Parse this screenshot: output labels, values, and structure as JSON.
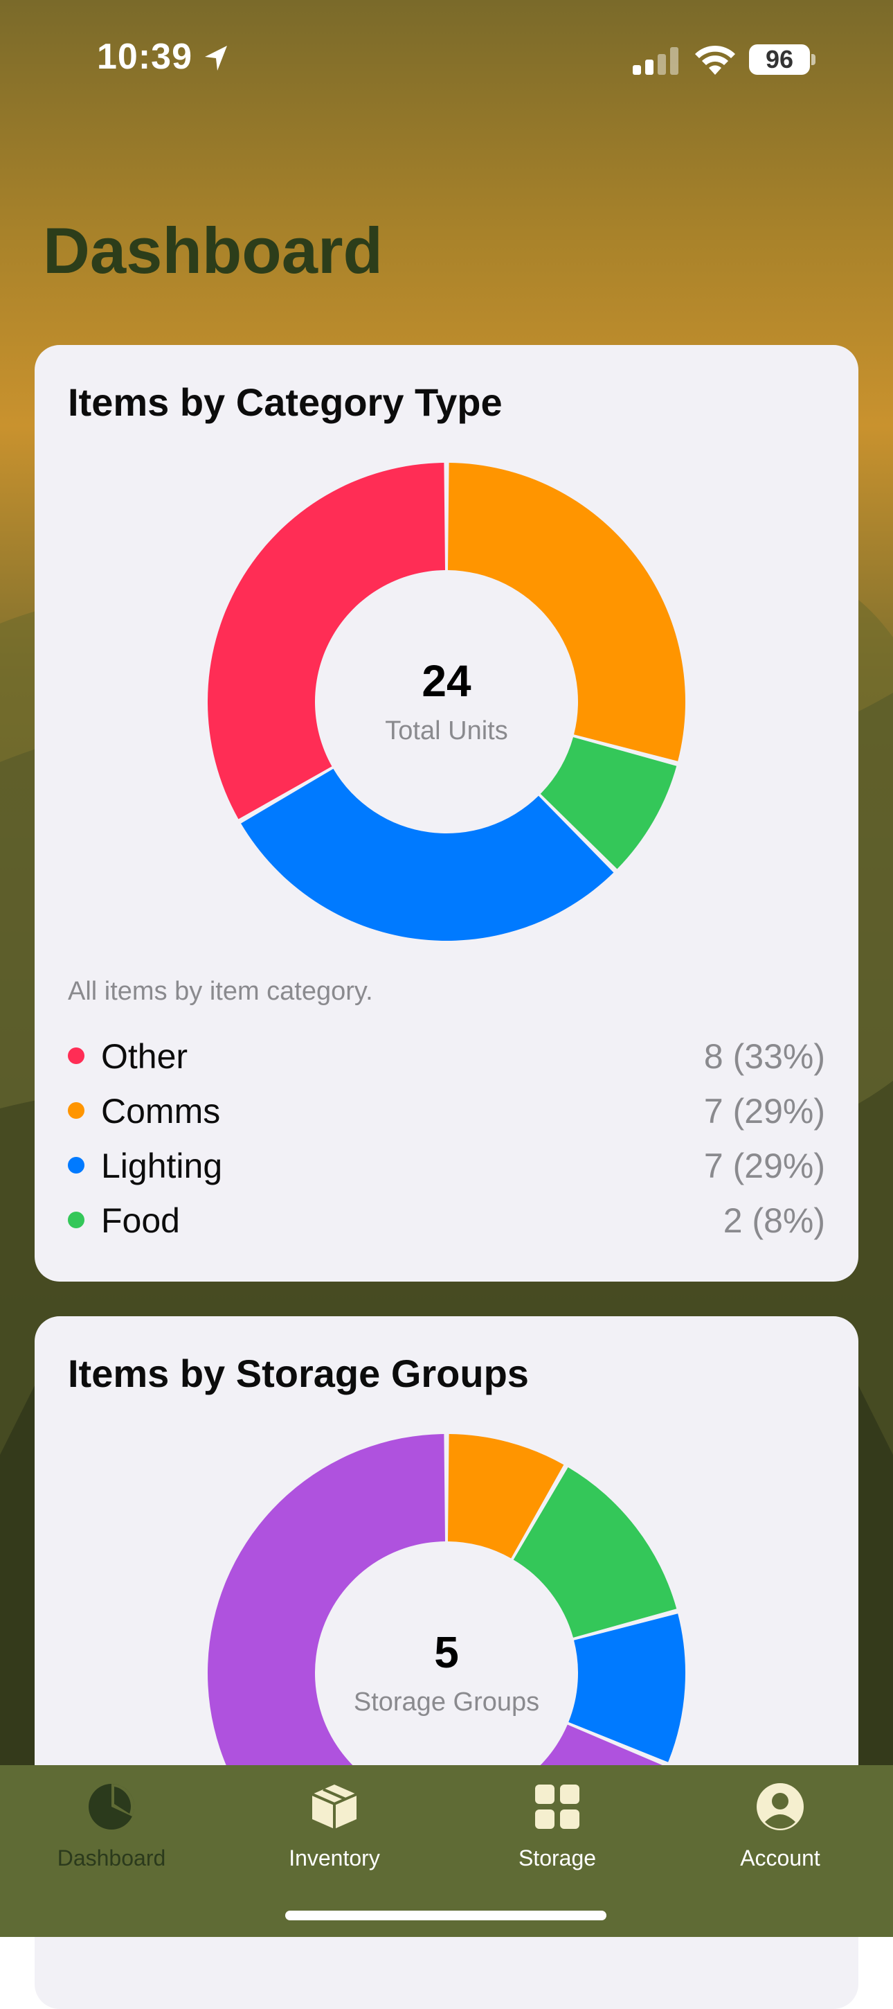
{
  "status_bar": {
    "time": "10:39",
    "battery": "96",
    "icons": [
      "location-arrow-icon",
      "signal-bars-icon",
      "wifi-icon",
      "battery-icon"
    ]
  },
  "header": {
    "title": "Dashboard"
  },
  "category_card": {
    "title": "Items by Category Type",
    "center_value": "24",
    "center_label": "Total Units",
    "caption": "All items by item category.",
    "legend": [
      {
        "label": "Other",
        "value": "8 (33%)",
        "color": "#ff2d55"
      },
      {
        "label": "Comms",
        "value": "7 (29%)",
        "color": "#ff9500"
      },
      {
        "label": "Lighting",
        "value": "7 (29%)",
        "color": "#007aff"
      },
      {
        "label": "Food",
        "value": "2 (8%)",
        "color": "#34c759"
      }
    ]
  },
  "storage_card": {
    "title": "Items by Storage Groups",
    "center_value": "5",
    "center_label": "Storage Groups"
  },
  "chart_data": [
    {
      "type": "pie",
      "title": "Items by Category Type",
      "categories": [
        "Other",
        "Comms",
        "Lighting",
        "Food"
      ],
      "values": [
        8,
        7,
        7,
        2
      ],
      "colors": [
        "#ff2d55",
        "#ff9500",
        "#007aff",
        "#34c759"
      ],
      "draw_order": [
        "Comms",
        "Food",
        "Lighting",
        "Other"
      ]
    },
    {
      "type": "pie",
      "title": "Items by Storage Groups",
      "categories": [
        "Orange group",
        "Green group",
        "Blue group",
        "Purple group"
      ],
      "values": [
        2,
        3,
        2.5,
        16.5
      ],
      "colors": [
        "#ff9500",
        "#34c759",
        "#007aff",
        "#af52de"
      ],
      "draw_order": [
        "Orange group",
        "Green group",
        "Blue group",
        "Purple group"
      ]
    }
  ],
  "tabbar": {
    "tabs": [
      {
        "label": "Dashboard",
        "icon": "pie-chart-icon",
        "active": true
      },
      {
        "label": "Inventory",
        "icon": "box-icon",
        "active": false
      },
      {
        "label": "Storage",
        "icon": "grid-icon",
        "active": false
      },
      {
        "label": "Account",
        "icon": "person-circle-icon",
        "active": false
      }
    ]
  }
}
